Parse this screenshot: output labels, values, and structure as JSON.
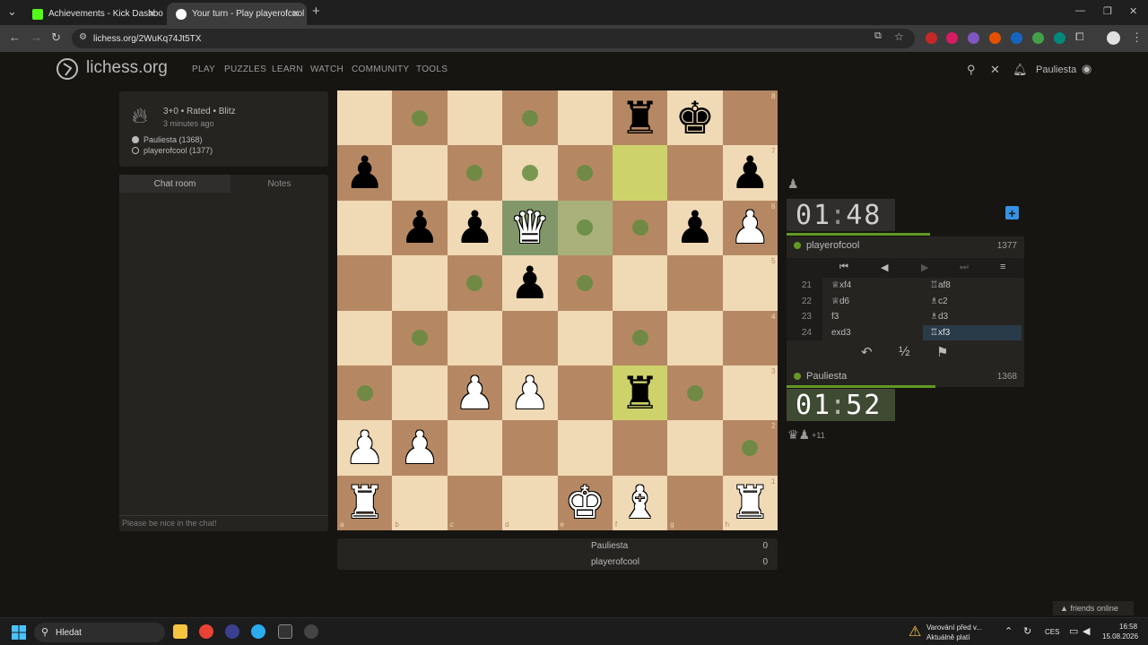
{
  "browser": {
    "tabs": [
      {
        "title": "Achievements - Kick Dashboard",
        "favicon_color": "#53fc18"
      },
      {
        "title": "Your turn - Play playerofcool",
        "favicon_color": "#ffffff"
      }
    ],
    "url": "lichess.org/2WuKq74Jt5TX"
  },
  "header": {
    "logo_text": "lichess.org",
    "nav": [
      "PLAY",
      "PUZZLES",
      "LEARN",
      "WATCH",
      "COMMUNITY",
      "TOOLS"
    ],
    "username": "Pauliesta"
  },
  "game_info": {
    "type": "3+0 • Rated • Blitz",
    "time_ago": "3 minutes ago",
    "white_player": "Pauliesta (1368)",
    "black_player": "playerofcool (1377)"
  },
  "chat": {
    "tab_chat": "Chat room",
    "tab_notes": "Notes",
    "placeholder": "Please be nice in the chat!"
  },
  "board": {
    "files": [
      "a",
      "b",
      "c",
      "d",
      "e",
      "f",
      "g",
      "h"
    ],
    "ranks": [
      "8",
      "7",
      "6",
      "5",
      "4",
      "3",
      "2",
      "1"
    ],
    "pieces": [
      {
        "sq": "f8",
        "p": "♜",
        "c": "b"
      },
      {
        "sq": "g8",
        "p": "♚",
        "c": "b"
      },
      {
        "sq": "a7",
        "p": "♟",
        "c": "b"
      },
      {
        "sq": "h7",
        "p": "♟",
        "c": "b"
      },
      {
        "sq": "b6",
        "p": "♟",
        "c": "b"
      },
      {
        "sq": "c6",
        "p": "♟",
        "c": "b"
      },
      {
        "sq": "d6",
        "p": "♛",
        "c": "w"
      },
      {
        "sq": "g6",
        "p": "♟",
        "c": "b"
      },
      {
        "sq": "h6",
        "p": "♟",
        "c": "w"
      },
      {
        "sq": "d5",
        "p": "♟",
        "c": "b"
      },
      {
        "sq": "c3",
        "p": "♟",
        "c": "w"
      },
      {
        "sq": "d3",
        "p": "♟",
        "c": "w"
      },
      {
        "sq": "f3",
        "p": "♜",
        "c": "b"
      },
      {
        "sq": "a2",
        "p": "♟",
        "c": "w"
      },
      {
        "sq": "b2",
        "p": "♟",
        "c": "w"
      },
      {
        "sq": "a1",
        "p": "♜",
        "c": "w"
      },
      {
        "sq": "e1",
        "p": "♚",
        "c": "w"
      },
      {
        "sq": "f1",
        "p": "♝",
        "c": "w"
      },
      {
        "sq": "h1",
        "p": "♜",
        "c": "w"
      }
    ],
    "last_move": [
      "f7",
      "f3"
    ],
    "selected": "d6",
    "move_dests": [
      "b8",
      "d8",
      "c7",
      "d7",
      "e7",
      "e6",
      "f6",
      "c5",
      "e5",
      "b4",
      "f4",
      "a3",
      "g3",
      "h2"
    ]
  },
  "scores": [
    {
      "name": "Pauliesta",
      "value": "0"
    },
    {
      "name": "playerofcool",
      "value": "0"
    }
  ],
  "clocks": {
    "top": {
      "min": "01",
      "sec": "48"
    },
    "bottom": {
      "min": "01",
      "sec": "52"
    }
  },
  "players": {
    "top": {
      "name": "playerofcool",
      "rating": "1377"
    },
    "bottom": {
      "name": "Pauliesta",
      "rating": "1368"
    }
  },
  "moves": [
    {
      "n": "21",
      "w": "♕xf4",
      "b": "♖af8"
    },
    {
      "n": "22",
      "w": "♕d6",
      "b": "♗c2"
    },
    {
      "n": "23",
      "w": "f3",
      "b": "♗d3"
    },
    {
      "n": "24",
      "w": "exd3",
      "b": "♖xf3"
    }
  ],
  "material": {
    "pieces": "♛♟",
    "diff": "+11"
  },
  "friends": "▲ friends online",
  "taskbar": {
    "search": "Hledat",
    "notice_line1": "Varování před v...",
    "notice_line2": "Aktuálně platí",
    "lang": "CES",
    "time": "16:58",
    "date": "15.08.2026"
  },
  "colors": {
    "accent_green": "#629924",
    "move_highlight": "#cdd26a",
    "dest_dot": "#648b40"
  }
}
